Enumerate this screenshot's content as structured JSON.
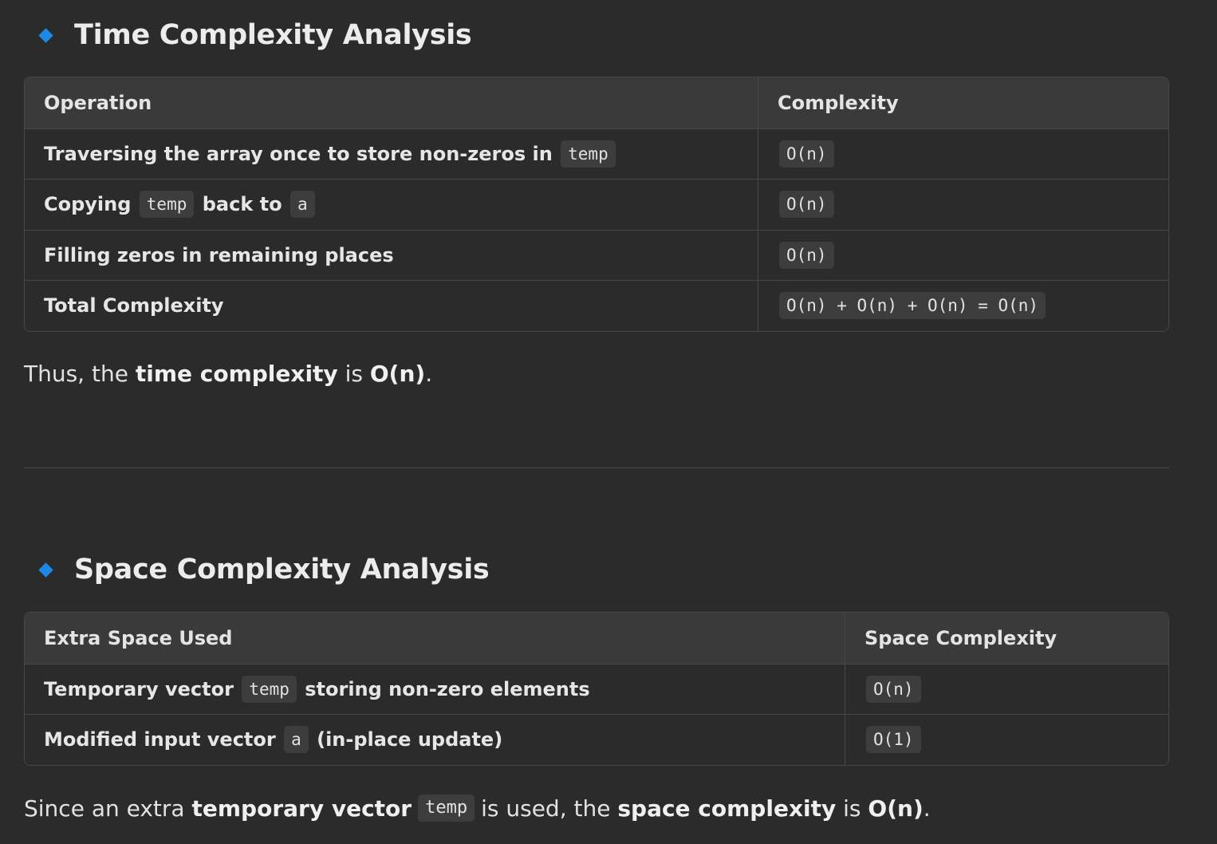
{
  "time_section": {
    "heading": "Time Complexity Analysis",
    "table": {
      "headers": [
        "Operation",
        "Complexity"
      ],
      "rows": [
        {
          "op_text": "Traversing the array once to store non-zeros in",
          "op_code": "temp",
          "complexity": "O(n)"
        },
        {
          "op_pre": "Copying",
          "op_code1": "temp",
          "op_mid": "back to",
          "op_code2": "a",
          "complexity": "O(n)"
        },
        {
          "op_text": "Filling zeros in remaining places",
          "complexity": "O(n)"
        },
        {
          "op_text": "Total Complexity",
          "complexity": "O(n) + O(n) + O(n) = O(n)"
        }
      ]
    },
    "conclusion": {
      "pre": "Thus, the",
      "bold": "time complexity",
      "mid": "is",
      "value": "O(n)",
      "post": "."
    }
  },
  "space_section": {
    "heading": "Space Complexity Analysis",
    "table": {
      "headers": [
        "Extra Space Used",
        "Space Complexity"
      ],
      "rows": [
        {
          "pre": "Temporary vector",
          "code": "temp",
          "post": "storing non-zero elements",
          "complexity": "O(n)"
        },
        {
          "pre": "Modified input vector",
          "code": "a",
          "post": "(in-place update)",
          "complexity": "O(1)"
        }
      ]
    },
    "conclusion": {
      "pre": "Since an extra",
      "bold1": "temporary vector",
      "code": "temp",
      "mid": "is used, the",
      "bold2": "space complexity",
      "mid2": "is",
      "value": "O(n)",
      "post": "."
    }
  },
  "colors": {
    "background": "#2b2b2b",
    "accent_diamond": "#1e88e5",
    "table_header": "#3a3a3a",
    "border": "#474747",
    "code_bg": "#3d3d3d"
  }
}
